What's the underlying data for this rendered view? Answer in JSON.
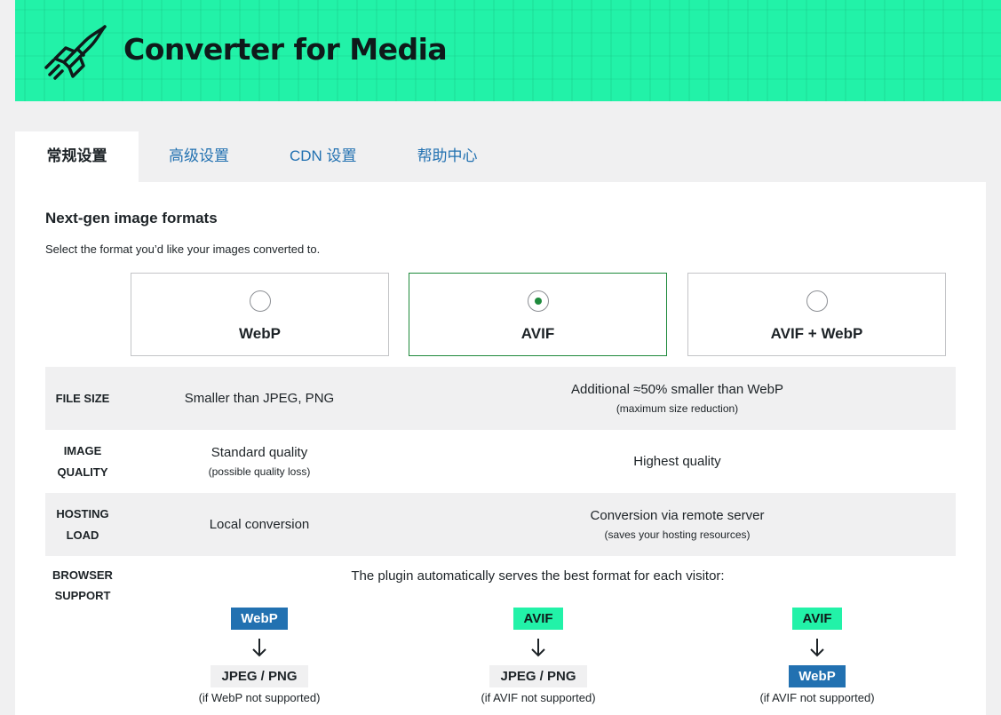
{
  "header": {
    "brand": "Converter for Media",
    "accent": "#22f2a8"
  },
  "tabs": [
    {
      "label": "常规设置",
      "active": true
    },
    {
      "label": "高级设置",
      "active": false
    },
    {
      "label": "CDN 设置",
      "active": false
    },
    {
      "label": "帮助中心",
      "active": false
    }
  ],
  "section": {
    "title": "Next-gen image formats",
    "description": "Select the format you’d like your images converted to."
  },
  "options": [
    {
      "label": "WebP",
      "selected": false
    },
    {
      "label": "AVIF",
      "selected": true
    },
    {
      "label": "AVIF + WebP",
      "selected": false
    }
  ],
  "rows": {
    "file_size": {
      "header": "FILE SIZE",
      "col1": "Smaller than JPEG, PNG",
      "col2": "Additional ≈50% smaller than WebP",
      "col2_sub": "(maximum size reduction)"
    },
    "image_quality": {
      "header_1": "IMAGE",
      "header_2": "QUALITY",
      "col1": "Standard quality",
      "col1_sub": "(possible quality loss)",
      "col2": "Highest quality"
    },
    "hosting_load": {
      "header_1": "HOSTING",
      "header_2": "LOAD",
      "col1": "Local conversion",
      "col2": "Conversion via remote server",
      "col2_sub": "(saves your hosting resources)"
    },
    "browser_support": {
      "header_1": "BROWSER",
      "header_2": "SUPPORT",
      "note": "The plugin automatically serves the best format for each visitor:"
    }
  },
  "fallbacks": [
    {
      "primary": "WebP",
      "fallback": "JPEG / PNG",
      "caption": "(if WebP not supported)"
    },
    {
      "primary": "AVIF",
      "fallback": "JPEG / PNG",
      "caption": "(if AVIF not supported)"
    },
    {
      "primary": "AVIF",
      "fallback": "WebP",
      "caption": "(if AVIF not supported)"
    }
  ]
}
